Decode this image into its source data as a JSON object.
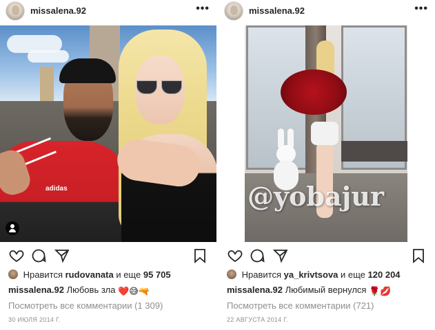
{
  "posts": [
    {
      "username": "missalena.92",
      "liked_by_user": "rudovanata",
      "liked_by_prefix": "Нравится",
      "liked_by_connector": "и еще",
      "likes_count": "95 705",
      "caption_user": "missalena.92",
      "caption_text": "Любовь зла",
      "caption_emoji": [
        "❤️",
        "😅",
        "🔫"
      ],
      "view_comments": "Посмотреть все комментарии (1 309)",
      "date": "30 ИЮЛЯ 2014 Г."
    },
    {
      "username": "missalena.92",
      "liked_by_user": "ya_krivtsova",
      "liked_by_prefix": "Нравится",
      "liked_by_connector": "и еще",
      "likes_count": "120 204",
      "caption_user": "missalena.92",
      "caption_text": "Любимый вернулся",
      "caption_emoji": [
        "🌹",
        "💋"
      ],
      "view_comments": "Посмотреть все комментарии (721)",
      "date": "22 АВГУСТА 2014 Г.",
      "watermark": "@yobajur"
    }
  ],
  "icons": {
    "more": "more-options-icon",
    "like": "heart-icon",
    "comment": "comment-icon",
    "share": "send-icon",
    "save": "bookmark-icon",
    "tag": "user-tag-icon"
  },
  "colors": {
    "text": "#262626",
    "muted": "#8e8e8e",
    "background": "#ffffff"
  }
}
